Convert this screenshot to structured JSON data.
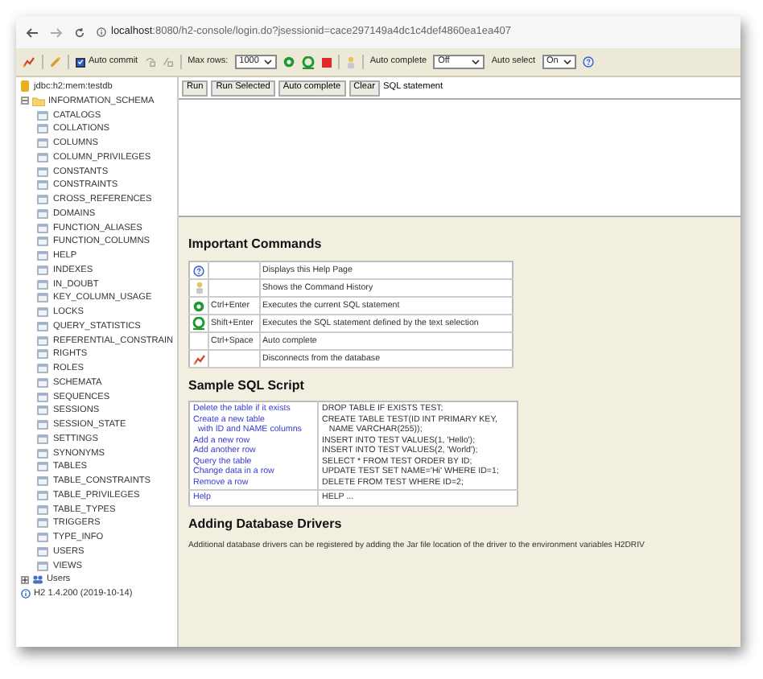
{
  "browser": {
    "url_host": "localhost",
    "url_path": ":8080/h2-console/login.do?jsessionid=cace297149a4dc1c4def4860ea1ea407"
  },
  "toolbar": {
    "auto_commit": {
      "label": "Auto commit",
      "checked": true
    },
    "max_rows_label": "Max rows:",
    "max_rows": "1000",
    "auto_complete_label": "Auto complete",
    "auto_complete": "Off",
    "auto_select_label": "Auto select",
    "auto_select": "On"
  },
  "tree": {
    "connection": "jdbc:h2:mem:testdb",
    "schema": {
      "label": "INFORMATION_SCHEMA",
      "expanded": true,
      "children": [
        "CATALOGS",
        "COLLATIONS",
        "COLUMNS",
        "COLUMN_PRIVILEGES",
        "CONSTANTS",
        "CONSTRAINTS",
        "CROSS_REFERENCES",
        "DOMAINS",
        "FUNCTION_ALIASES",
        "FUNCTION_COLUMNS",
        "HELP",
        "INDEXES",
        "IN_DOUBT",
        "KEY_COLUMN_USAGE",
        "LOCKS",
        "QUERY_STATISTICS",
        "REFERENTIAL_CONSTRAIN",
        "RIGHTS",
        "ROLES",
        "SCHEMATA",
        "SEQUENCES",
        "SESSIONS",
        "SESSION_STATE",
        "SETTINGS",
        "SYNONYMS",
        "TABLES",
        "TABLE_CONSTRAINTS",
        "TABLE_PRIVILEGES",
        "TABLE_TYPES",
        "TRIGGERS",
        "TYPE_INFO",
        "USERS",
        "VIEWS"
      ]
    },
    "users": {
      "label": "Users",
      "expanded": false
    },
    "version": "H2 1.4.200 (2019-10-14)"
  },
  "sql_buttons": [
    "Run",
    "Run Selected",
    "Auto complete",
    "Clear"
  ],
  "sql_label": "SQL statement",
  "commands": {
    "title": "Important Commands",
    "rows": [
      {
        "kind": "help",
        "shortcut": "",
        "description": "Displays this Help Page"
      },
      {
        "kind": "history",
        "shortcut": "",
        "description": "Shows the Command History"
      },
      {
        "kind": "run",
        "shortcut": "Ctrl+Enter",
        "description": "Executes the current SQL statement"
      },
      {
        "kind": "run_selected",
        "shortcut": "Shift+Enter",
        "description": "Executes the SQL statement defined by the text selection"
      },
      {
        "kind": "none",
        "shortcut": "Ctrl+Space",
        "description": "Auto complete"
      },
      {
        "kind": "disconnect",
        "shortcut": "",
        "description": "Disconnects from the database"
      }
    ]
  },
  "sample": {
    "title": "Sample SQL Script",
    "groups": [
      {
        "actions": [
          "Delete the table if it exists",
          "Create a new table",
          "  with ID and NAME columns",
          "Add a new row",
          "Add another row",
          "Query the table",
          "Change data in a row",
          "Remove a row"
        ],
        "sql": [
          "DROP TABLE IF EXISTS TEST;",
          "CREATE TABLE TEST(ID INT PRIMARY KEY,",
          "   NAME VARCHAR(255));",
          "INSERT INTO TEST VALUES(1, 'Hello');",
          "INSERT INTO TEST VALUES(2, 'World');",
          "SELECT * FROM TEST ORDER BY ID;",
          "UPDATE TEST SET NAME='Hi' WHERE ID=1;",
          "DELETE FROM TEST WHERE ID=2;"
        ]
      },
      {
        "actions": [
          "Help"
        ],
        "sql": [
          "HELP ..."
        ]
      }
    ]
  },
  "drivers": {
    "title": "Adding Database Drivers",
    "text": "Additional database drivers can be registered by adding the Jar file location of the driver to the environment variables H2DRIV"
  }
}
